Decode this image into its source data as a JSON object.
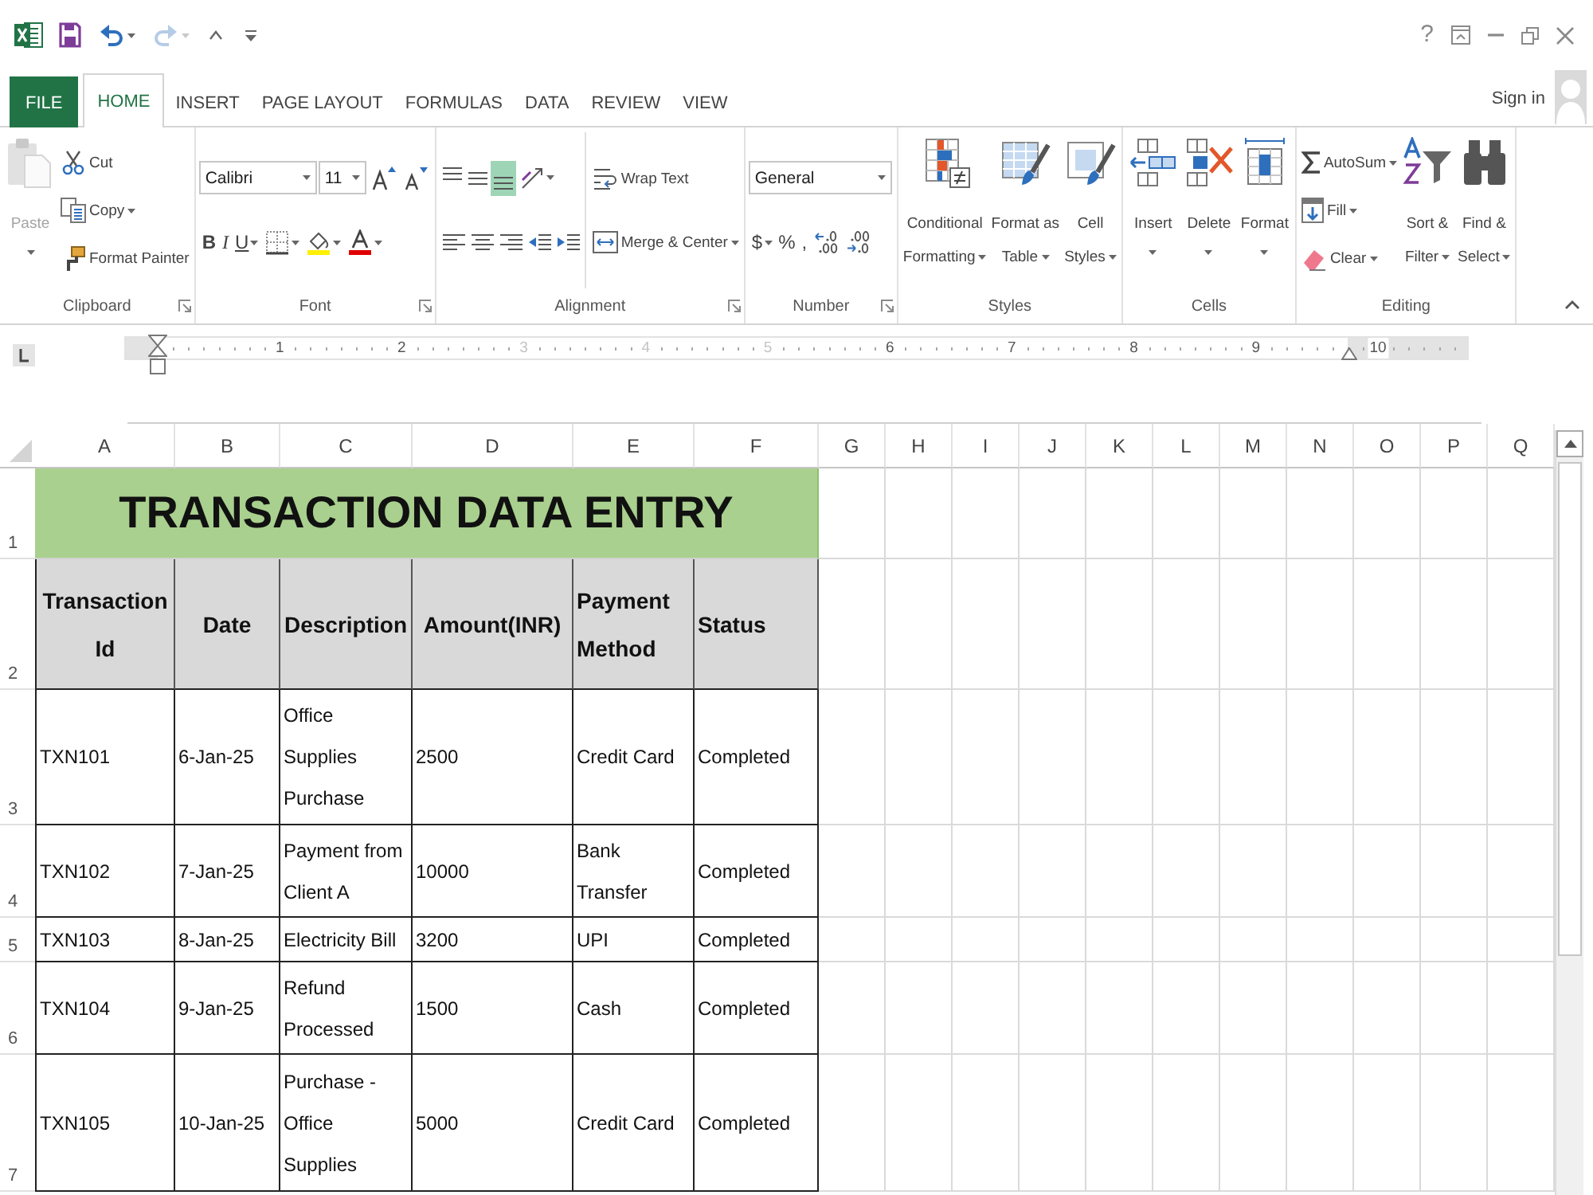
{
  "quick_access_toolbar": [
    {
      "disabled": false,
      "dropdown": false
    },
    {
      "disabled": false,
      "dropdown": true
    },
    {
      "disabled": true,
      "dropdown": true
    },
    {
      "disabled": false,
      "dropdown": false
    }
  ],
  "window_controls": {
    "help": "?"
  },
  "ribbon": {
    "tabs": [
      {
        "label": "FILE",
        "kind": "backstage",
        "selected": false
      },
      {
        "label": "HOME",
        "kind": "tab",
        "selected": true
      },
      {
        "label": "INSERT",
        "kind": "tab",
        "selected": false
      },
      {
        "label": "PAGE LAYOUT",
        "kind": "tab",
        "selected": false
      },
      {
        "label": "FORMULAS",
        "kind": "tab",
        "selected": false
      },
      {
        "label": "DATA",
        "kind": "tab",
        "selected": false
      },
      {
        "label": "REVIEW",
        "kind": "tab",
        "selected": false
      },
      {
        "label": "VIEW",
        "kind": "tab",
        "selected": false
      }
    ],
    "account": {
      "label": "Sign in"
    },
    "groups": [
      {
        "label": "Clipboard",
        "dialog_launcher": true,
        "sections": [
          {
            "kind": "split",
            "label": "Paste",
            "dropdown": true,
            "disabled": true
          },
          {
            "kind": "stack",
            "items": [
              {
                "label": "Cut",
                "dropdown": false,
                "disabled": false
              },
              {
                "label": "Copy",
                "dropdown": true,
                "disabled": false
              },
              {
                "label": "Format Painter",
                "dropdown": false,
                "disabled": false
              }
            ]
          }
        ]
      },
      {
        "label": "Font",
        "dialog_launcher": true,
        "sections": [
          {
            "kind": "lines",
            "lines": [
              {
                "tools": [
                  {
                    "kind": "combo",
                    "value": "Calibri"
                  },
                  {
                    "kind": "combo",
                    "value": "11"
                  },
                  {
                    "kind": "icon",
                    "dropdown": false
                  },
                  {
                    "kind": "icon",
                    "dropdown": false
                  }
                ]
              },
              {
                "tools": [
                  {
                    "kind": "glyph",
                    "label": "B",
                    "dropdown": false
                  },
                  {
                    "kind": "glyph",
                    "label": "I",
                    "dropdown": false
                  },
                  {
                    "kind": "glyph",
                    "label": "U",
                    "dropdown": true
                  },
                  {
                    "kind": "icon",
                    "dropdown": true
                  },
                  {
                    "kind": "icon",
                    "dropdown": true
                  },
                  {
                    "kind": "icon",
                    "dropdown": true
                  }
                ]
              }
            ]
          }
        ]
      },
      {
        "label": "Alignment",
        "dialog_launcher": true,
        "sections": [
          {
            "kind": "lines",
            "lines": [
              {
                "tools": [
                  {
                    "kind": "icon",
                    "dropdown": false,
                    "on": false
                  },
                  {
                    "kind": "icon",
                    "dropdown": false,
                    "on": false
                  },
                  {
                    "kind": "icon",
                    "dropdown": false,
                    "on": true
                  },
                  {
                    "kind": "icon",
                    "dropdown": true,
                    "on": false
                  }
                ]
              },
              {
                "tools": [
                  {
                    "kind": "icon",
                    "dropdown": false,
                    "on": false
                  },
                  {
                    "kind": "icon",
                    "dropdown": false,
                    "on": false
                  },
                  {
                    "kind": "icon",
                    "dropdown": false,
                    "on": false
                  },
                  {
                    "kind": "icon",
                    "dropdown": false,
                    "on": false
                  },
                  {
                    "kind": "icon",
                    "dropdown": false,
                    "on": false
                  }
                ]
              }
            ]
          },
          {
            "kind": "stack",
            "items": [
              {
                "label": "Wrap Text",
                "dropdown": false,
                "on": false
              },
              {
                "label": "Merge & Center",
                "dropdown": true,
                "on": false
              }
            ]
          }
        ]
      },
      {
        "label": "Number",
        "dialog_launcher": true,
        "sections": [
          {
            "kind": "lines",
            "lines": [
              {
                "tools": [
                  {
                    "kind": "combo",
                    "value": "General"
                  }
                ]
              },
              {
                "tools": [
                  {
                    "kind": "glyph",
                    "label": "$",
                    "dropdown": true
                  },
                  {
                    "kind": "glyph",
                    "label": "%",
                    "dropdown": false
                  },
                  {
                    "kind": "glyph",
                    "label": ",",
                    "dropdown": false
                  },
                  {
                    "kind": "icon",
                    "dropdown": false
                  },
                  {
                    "kind": "icon",
                    "dropdown": false
                  }
                ]
              }
            ]
          }
        ]
      },
      {
        "label": "Styles",
        "dialog_launcher": false,
        "sections": [
          {
            "kind": "large",
            "label": "Conditional Formatting",
            "dropdown": true
          },
          {
            "kind": "large",
            "label": "Format as Table",
            "dropdown": true
          },
          {
            "kind": "large",
            "label": "Cell Styles",
            "dropdown": true
          }
        ]
      },
      {
        "label": "Cells",
        "dialog_launcher": false,
        "sections": [
          {
            "kind": "split",
            "label": "Insert",
            "dropdown": true
          },
          {
            "kind": "split",
            "label": "Delete",
            "dropdown": true
          },
          {
            "kind": "split",
            "label": "Format",
            "dropdown": true
          }
        ]
      },
      {
        "label": "Editing",
        "dialog_launcher": false,
        "sections": [
          {
            "kind": "stack",
            "items": [
              {
                "label": "AutoSum",
                "dropdown": true
              },
              {
                "label": "Fill",
                "dropdown": true
              },
              {
                "label": "Clear",
                "dropdown": true
              }
            ]
          },
          {
            "kind": "large",
            "label": "Sort & Filter",
            "dropdown": true
          },
          {
            "kind": "large",
            "label": "Find & Select",
            "dropdown": true
          }
        ]
      }
    ]
  },
  "ruler": {
    "labels": [
      {
        "text": "1",
        "dimmed": false
      },
      {
        "text": "2",
        "dimmed": false
      },
      {
        "text": "3",
        "dimmed": true
      },
      {
        "text": "4",
        "dimmed": true
      },
      {
        "text": "5",
        "dimmed": true
      },
      {
        "text": "6",
        "dimmed": false
      },
      {
        "text": "7",
        "dimmed": false
      },
      {
        "text": "8",
        "dimmed": false
      },
      {
        "text": "9",
        "dimmed": false
      },
      {
        "text": "10",
        "dimmed": false
      }
    ]
  },
  "sheet": {
    "column_headers": [
      "A",
      "B",
      "C",
      "D",
      "E",
      "F",
      "G",
      "H",
      "I",
      "J",
      "K",
      "L",
      "M",
      "N",
      "O",
      "P",
      "Q"
    ],
    "row_headers": [
      "1",
      "2",
      "3",
      "4",
      "5",
      "6",
      "7"
    ],
    "title": "TRANSACTION DATA ENTRY",
    "table": {
      "columns": [
        "Transaction Id",
        "Date",
        "Description",
        "Amount(INR)",
        "Payment Method",
        "Status"
      ],
      "rows": [
        [
          "TXN101",
          "6-Jan-25",
          "Office Supplies Purchase",
          "2500",
          "Credit Card",
          "Completed"
        ],
        [
          "TXN102",
          "7-Jan-25",
          "Payment from Client A",
          "10000",
          "Bank Transfer",
          "Completed"
        ],
        [
          "TXN103",
          "8-Jan-25",
          "Electricity Bill",
          "3200",
          "UPI",
          "Completed"
        ],
        [
          "TXN104",
          "9-Jan-25",
          "Refund Processed",
          "1500",
          "Cash",
          "Completed"
        ],
        [
          "TXN105",
          "10-Jan-25",
          "Purchase - Office Supplies",
          "5000",
          "Credit Card",
          "Completed"
        ]
      ]
    }
  }
}
